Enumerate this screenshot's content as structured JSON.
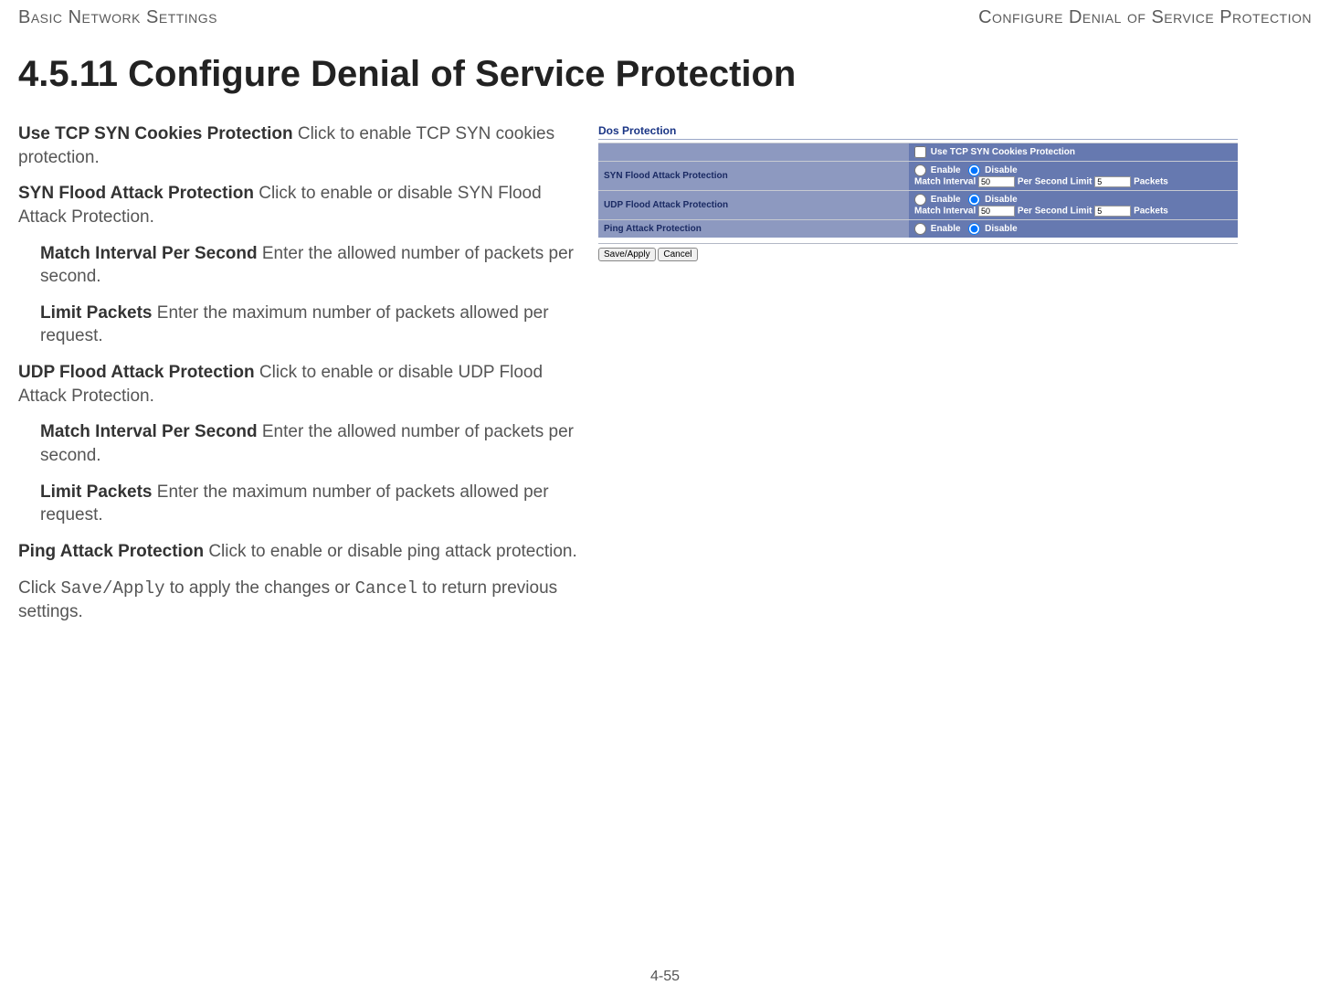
{
  "header": {
    "left": "Basic Network Settings",
    "right": "Configure Denial of Service Protection"
  },
  "heading": "4.5.11 Configure Denial of Service Protection",
  "descriptions": {
    "syn_cookies_label": "Use TCP SYN Cookies Protection",
    "syn_cookies_text": "  Click to enable TCP SYN cookies protection.",
    "syn_flood_label": "SYN Flood Attack Protection",
    "syn_flood_text": "  Click to enable or disable SYN Flood Attack Protection.",
    "match_interval_label": "Match Interval Per Second",
    "match_interval_text": "   Enter the allowed number of packets per second.",
    "limit_packets_label": "Limit Packets",
    "limit_packets_text": "  Enter the maximum number of packets allowed per request.",
    "udp_flood_label": "UDP Flood Attack Protection",
    "udp_flood_text": "  Click to enable or disable UDP Flood Attack Protection.",
    "ping_label": "Ping Attack Protection",
    "ping_text": "  Click to enable or disable ping attack protection.",
    "final_pre": "Click ",
    "final_save": "Save/Apply",
    "final_mid": " to apply the changes or ",
    "final_cancel": "Cancel",
    "final_post": " to return previous settings."
  },
  "panel": {
    "title": "Dos Protection",
    "use_syn_cookies": "Use TCP SYN Cookies Protection",
    "syn_row": "SYN Flood Attack Protection",
    "udp_row": "UDP Flood Attack Protection",
    "ping_row": "Ping Attack Protection",
    "enable": "Enable",
    "disable": "Disable",
    "match_interval": "Match Interval",
    "per_second_limit": "Per Second  Limit",
    "packets": "Packets",
    "syn_match_value": "50",
    "syn_limit_value": "5",
    "udp_match_value": "50",
    "udp_limit_value": "5",
    "save_apply_btn": "Save/Apply",
    "cancel_btn": "Cancel"
  },
  "page_number": "4-55"
}
